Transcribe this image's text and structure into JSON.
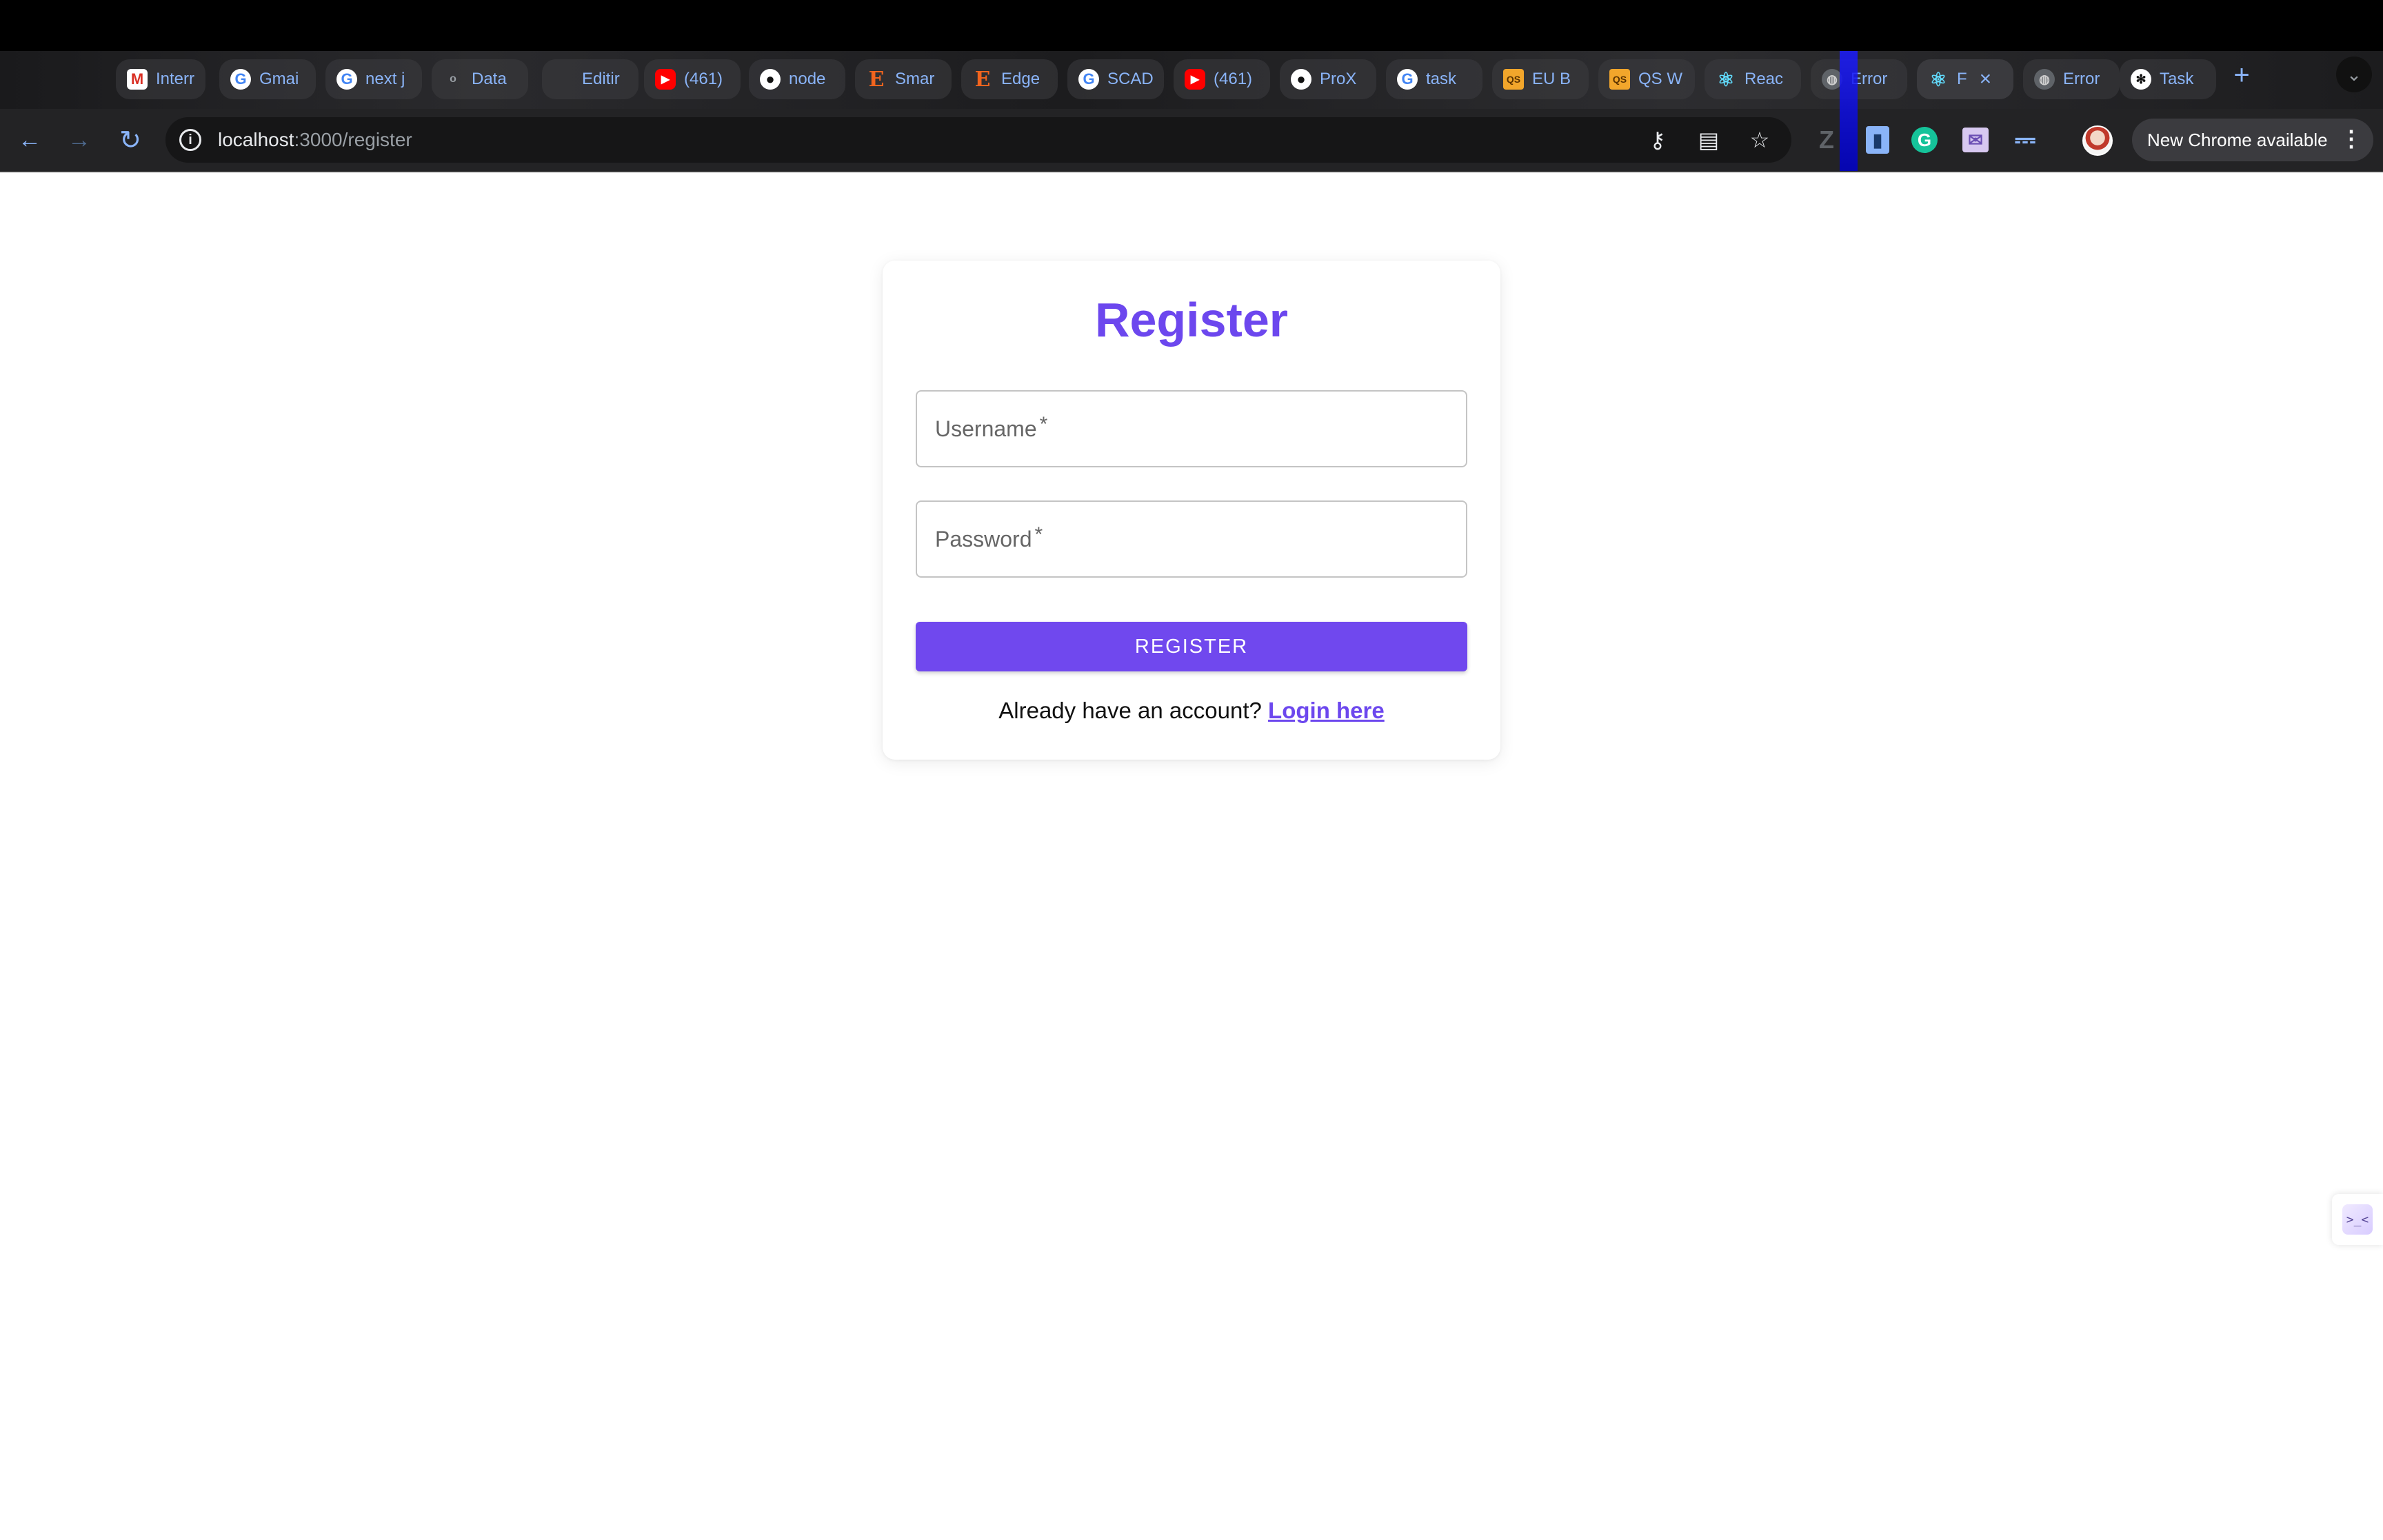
{
  "browser": {
    "tabs": [
      {
        "title": "Interr",
        "icon": "gmail-icon",
        "glyph": "M"
      },
      {
        "title": "Gmai",
        "icon": "google-icon",
        "glyph": "G"
      },
      {
        "title": "next j",
        "icon": "google-icon",
        "glyph": "G"
      },
      {
        "title": "Data",
        "icon": "dot-icon",
        "glyph": "o"
      },
      {
        "title": "Editir",
        "icon": "blank-icon",
        "glyph": ""
      },
      {
        "title": "(461)",
        "icon": "youtube-icon",
        "glyph": "▶"
      },
      {
        "title": "node",
        "icon": "github-icon",
        "glyph": "●"
      },
      {
        "title": "Smar",
        "icon": "etsy-icon",
        "glyph": "E"
      },
      {
        "title": "Edge",
        "icon": "etsy-icon",
        "glyph": "E"
      },
      {
        "title": "SCAD",
        "icon": "google-icon",
        "glyph": "G"
      },
      {
        "title": "(461)",
        "icon": "youtube-icon",
        "glyph": "▶"
      },
      {
        "title": "ProX",
        "icon": "github-icon",
        "glyph": "●"
      },
      {
        "title": "task",
        "icon": "google-icon",
        "glyph": "G"
      },
      {
        "title": "EU B",
        "icon": "qs-icon",
        "glyph": "QS"
      },
      {
        "title": "QS W",
        "icon": "qs-icon",
        "glyph": "QS"
      },
      {
        "title": "Reac",
        "icon": "react-icon",
        "glyph": "⚛"
      },
      {
        "title": "Error",
        "icon": "globe-icon",
        "glyph": "◍"
      },
      {
        "title": "F",
        "icon": "react-icon",
        "glyph": "⚛"
      },
      {
        "title": "Error",
        "icon": "globe-icon",
        "glyph": "◍"
      },
      {
        "title": "Task",
        "icon": "chatgpt-icon",
        "glyph": "✻"
      }
    ],
    "new_tab_glyph": "+",
    "tab_close_glyph": "×",
    "tab_search_glyph": "⌄",
    "url_host": "localhost",
    "url_rest": ":3000/register",
    "update_text": "New Chrome available",
    "accent_color": "#8ab4f8"
  },
  "page": {
    "title": "Register",
    "username_label": "Username",
    "password_label": "Password",
    "required_mark": "*",
    "register_button": "REGISTER",
    "login_prompt": "Already have an account?",
    "login_link": "Login here",
    "brand_color": "#6c47ee",
    "button_color": "#7048ee"
  }
}
